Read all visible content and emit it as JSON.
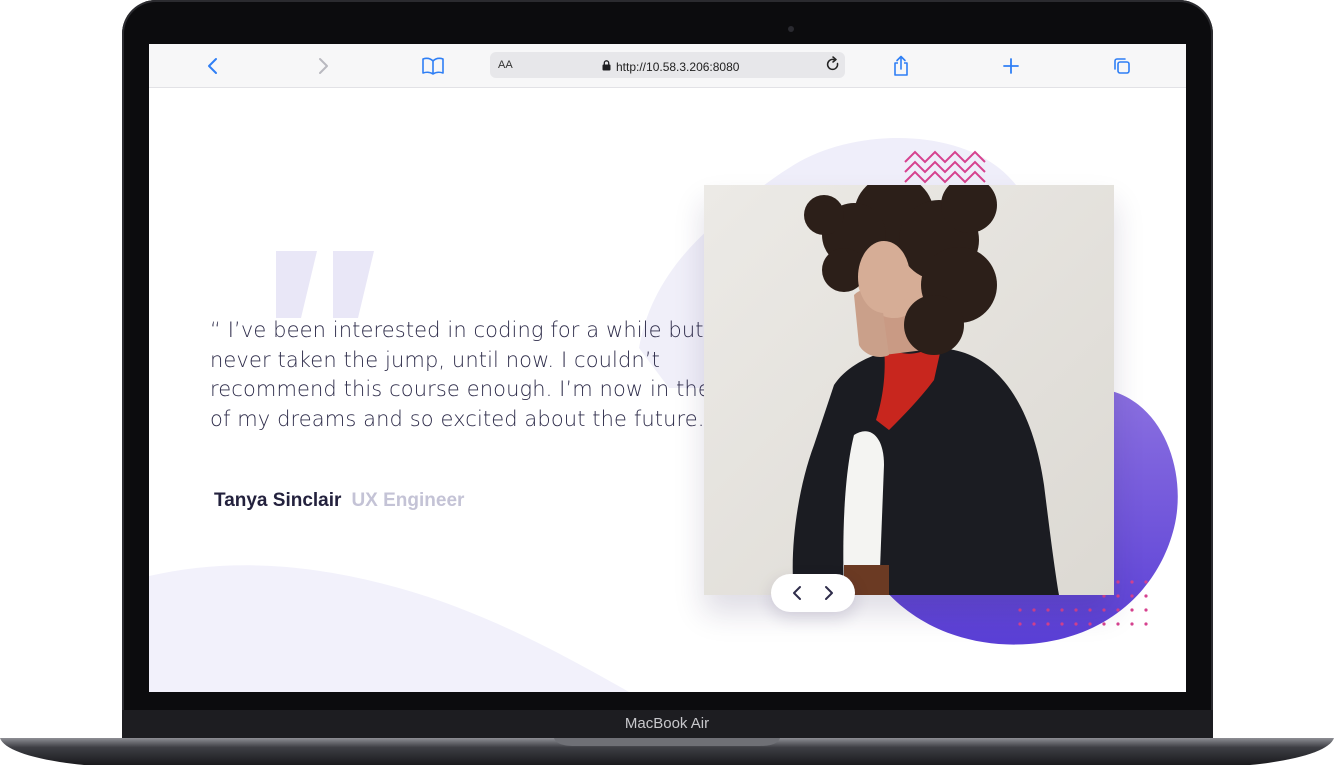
{
  "device": {
    "label": "MacBook Air"
  },
  "browser": {
    "text_size_label": "AA",
    "url": "http://10.58.3.206:8080",
    "icons": [
      "back-icon",
      "forward-icon",
      "bookmarks-icon",
      "lock-icon",
      "reload-icon",
      "share-icon",
      "new-tab-icon",
      "tabs-icon"
    ]
  },
  "testimonial": {
    "quote": "“ I’ve been interested in coding for a while but never taken the jump, until now. I couldn’t recommend this course enough. I’m now in the job of my dreams and so excited about the future. “",
    "author_name": "Tanya Sinclair",
    "author_role": "UX Engineer"
  },
  "slider": {
    "icons": [
      "chevron-left-icon",
      "chevron-right-icon"
    ]
  },
  "colors": {
    "accent_purple": "#6a4fd8",
    "accent_pink": "#d6428f",
    "text_dark": "#2e2c4a",
    "text_muted": "#c4c3d6",
    "link_blue": "#2f7ff5"
  }
}
